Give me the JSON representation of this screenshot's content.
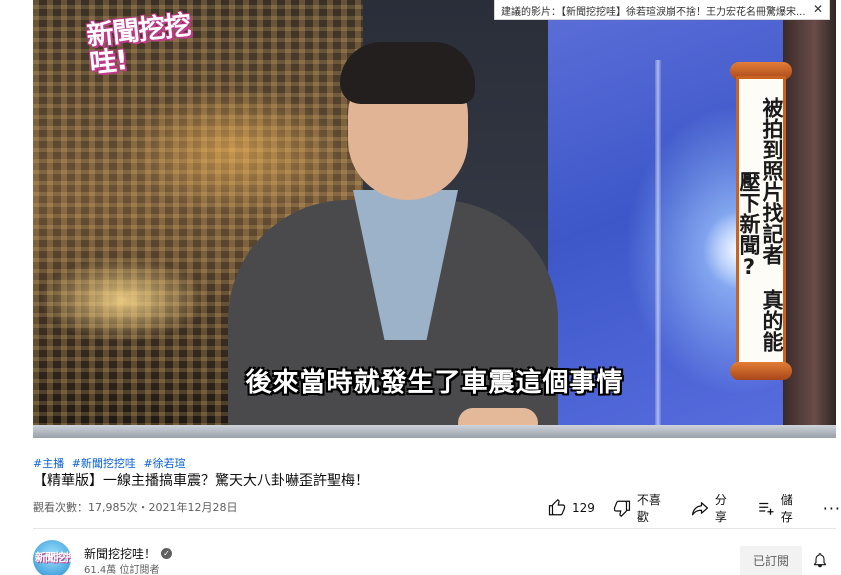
{
  "player": {
    "show_logo_text": "新聞挖挖哇!",
    "subtitle": "後來當時就發生了車震這個事情",
    "banner_text": "被拍到照片找記者 真的能壓下新聞?",
    "watch_next_label": "建議的影片：【新聞挖挖哇】徐若瑄淚崩不捨！王力宏花名冊驚爆宋...",
    "watch_next_close_icon": "close-icon"
  },
  "video": {
    "hashtags": [
      "#主播",
      "#新聞挖挖哇",
      "#徐若瑄"
    ],
    "title": "【精華版】一線主播搞車震？驚天大八卦嚇歪許聖梅！",
    "views_and_date": "觀看次數：17,985次・2021年12月28日"
  },
  "actions": {
    "like_icon": "thumbs-up-icon",
    "like_count": "129",
    "dislike_icon": "thumbs-down-icon",
    "dislike_label": "不喜歡",
    "share_icon": "share-icon",
    "share_label": "分享",
    "save_icon": "playlist-add-icon",
    "save_label": "儲存",
    "more_icon": "more-horizontal-icon",
    "more_label": "···"
  },
  "channel": {
    "avatar_text": "新聞挖挖哇",
    "name": "新聞挖挖哇！",
    "verified_icon": "verified-check-icon",
    "subscribers": "61.4萬 位訂閱者",
    "subscribed_label": "已訂閱",
    "bell_icon": "notification-bell-icon"
  },
  "colors": {
    "link_blue": "#065fd4",
    "secondary_text": "#606060",
    "subscribed_bg": "#f2f2f2"
  }
}
